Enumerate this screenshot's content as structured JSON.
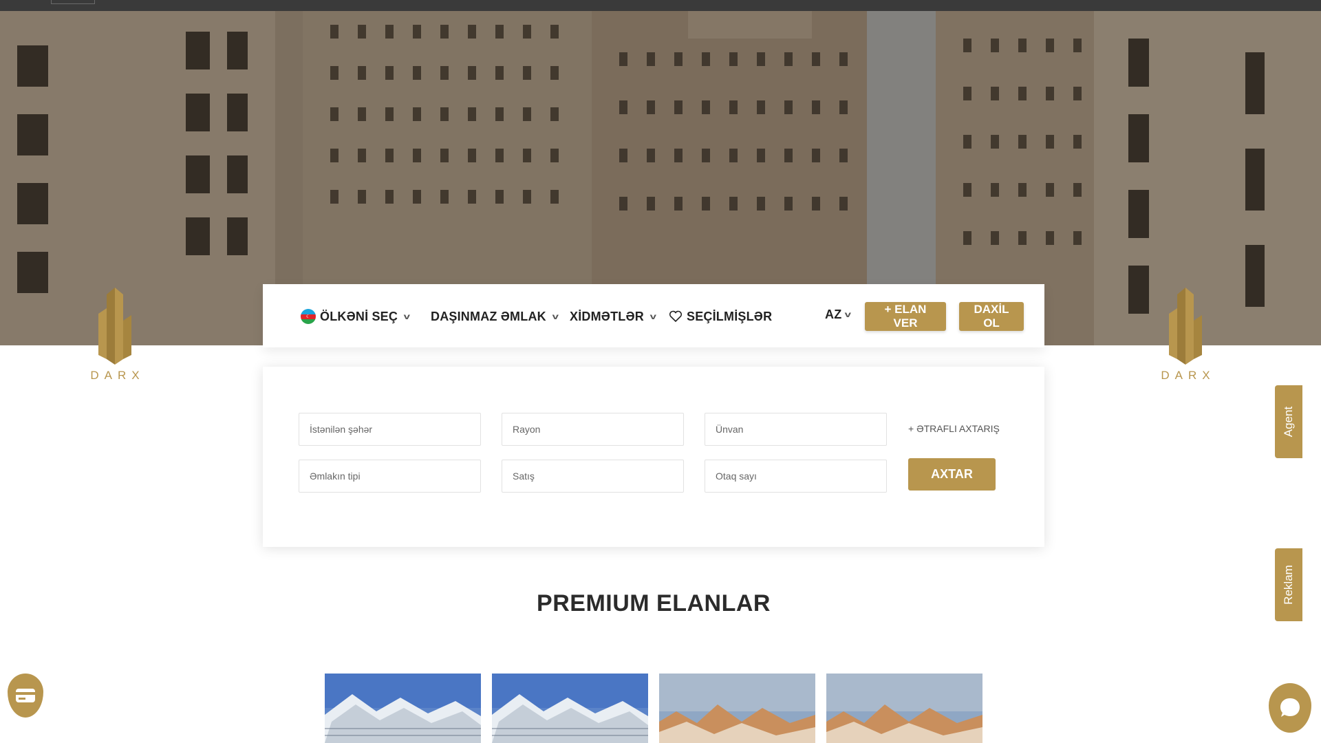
{
  "brand": {
    "name": "DARX",
    "gold": "#b8964e"
  },
  "nav": {
    "country_label": "ÖLKƏNİ SEÇ",
    "country_flag": "azerbaijan-flag-icon",
    "real_estate_label": "DAŞINMAZ ƏMLAK",
    "services_label": "XİDMƏTLƏR",
    "favorites_label": "SEÇİLMİŞLƏR",
    "language_label": "AZ",
    "post_ad_label": "+ ELAN VER",
    "login_label": "DAXİL OL"
  },
  "search": {
    "city_placeholder": "İstənilən şəhər",
    "district_placeholder": "Rayon",
    "address_placeholder": "Ünvan",
    "advanced_label": "+ ƏTRAFLI AXTARIŞ",
    "property_type_placeholder": "Əmlakın tipi",
    "deal_type_placeholder": "Satış",
    "rooms_placeholder": "Otaq sayı",
    "search_button_label": "AXTAR"
  },
  "premium": {
    "title": "PREMIUM ELANLAR",
    "listings": [
      {
        "image": "building-photo-blue-sky"
      },
      {
        "image": "building-photo-blue-sky"
      },
      {
        "image": "building-photo-beige"
      },
      {
        "image": "building-photo-beige"
      }
    ]
  },
  "side_tabs": {
    "agent_label": "Agent",
    "ads_label": "Reklam"
  },
  "floating": {
    "left_icon": "credit-card-icon",
    "right_icon": "chat-bubble-icon"
  }
}
